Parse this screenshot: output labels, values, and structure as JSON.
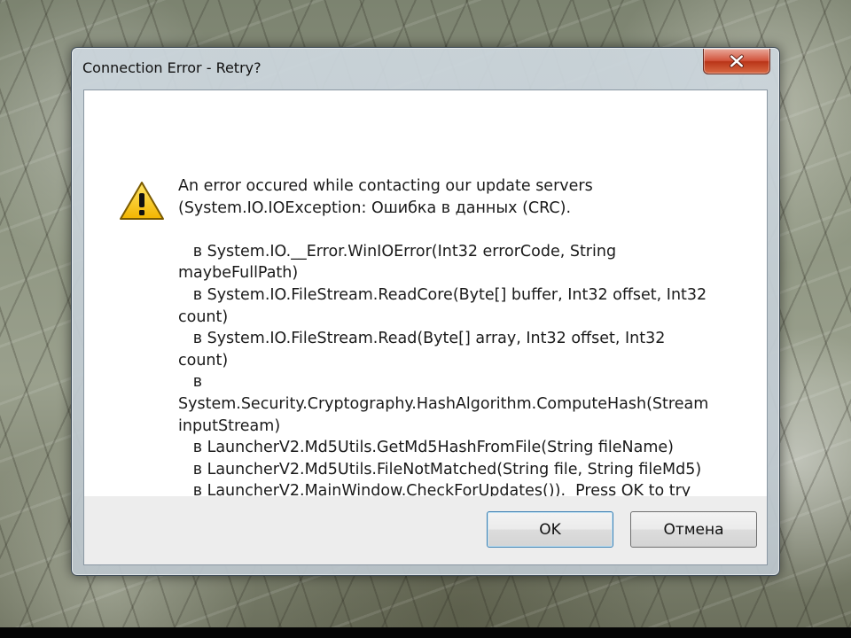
{
  "dialog": {
    "title": "Connection Error - Retry?",
    "message": "An error occured while contacting our update servers\n(System.IO.IOException: Ошибка в данных (CRC).\n\n   в System.IO.__Error.WinIOError(Int32 errorCode, String\nmaybeFullPath)\n   в System.IO.FileStream.ReadCore(Byte[] buffer, Int32 offset, Int32\ncount)\n   в System.IO.FileStream.Read(Byte[] array, Int32 offset, Int32 count)\n   в\nSystem.Security.Cryptography.HashAlgorithm.ComputeHash(Stream\ninputStream)\n   в LauncherV2.Md5Utils.GetMd5HashFromFile(String fileName)\n   в LauncherV2.Md5Utils.FileNotMatched(String file, String fileMd5)\n   в LauncherV2.MainWindow.CheckForUpdates()).  Press OK to try\nagain or cancel to visit our download page.",
    "icon": "warning-icon",
    "buttons": {
      "ok_label": "OK",
      "cancel_label": "Отмена"
    },
    "colors": {
      "close_button": "#c9452b",
      "ok_button_border": "#3c7fb1",
      "warning_fill": "#f5c400"
    }
  }
}
